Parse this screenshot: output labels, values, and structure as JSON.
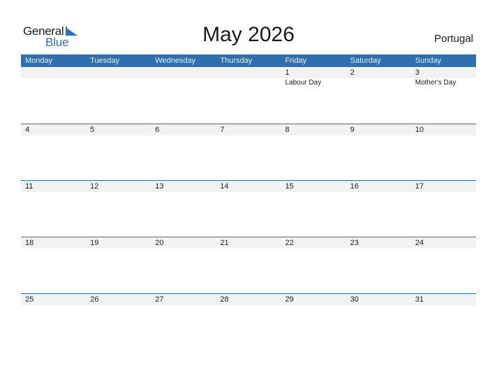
{
  "logo": {
    "line1": "General",
    "line2": "Blue"
  },
  "title": "May 2026",
  "country": "Portugal",
  "colors": {
    "accent": "#2e6fad",
    "strip": "#f2f2f2"
  },
  "days": [
    "Monday",
    "Tuesday",
    "Wednesday",
    "Thursday",
    "Friday",
    "Saturday",
    "Sunday"
  ],
  "weeks": [
    [
      {
        "d": "",
        "h": ""
      },
      {
        "d": "",
        "h": ""
      },
      {
        "d": "",
        "h": ""
      },
      {
        "d": "",
        "h": ""
      },
      {
        "d": "1",
        "h": "Labour Day"
      },
      {
        "d": "2",
        "h": ""
      },
      {
        "d": "3",
        "h": "Mother's Day"
      }
    ],
    [
      {
        "d": "4",
        "h": ""
      },
      {
        "d": "5",
        "h": ""
      },
      {
        "d": "6",
        "h": ""
      },
      {
        "d": "7",
        "h": ""
      },
      {
        "d": "8",
        "h": ""
      },
      {
        "d": "9",
        "h": ""
      },
      {
        "d": "10",
        "h": ""
      }
    ],
    [
      {
        "d": "11",
        "h": ""
      },
      {
        "d": "12",
        "h": ""
      },
      {
        "d": "13",
        "h": ""
      },
      {
        "d": "14",
        "h": ""
      },
      {
        "d": "15",
        "h": ""
      },
      {
        "d": "16",
        "h": ""
      },
      {
        "d": "17",
        "h": ""
      }
    ],
    [
      {
        "d": "18",
        "h": ""
      },
      {
        "d": "19",
        "h": ""
      },
      {
        "d": "20",
        "h": ""
      },
      {
        "d": "21",
        "h": ""
      },
      {
        "d": "22",
        "h": ""
      },
      {
        "d": "23",
        "h": ""
      },
      {
        "d": "24",
        "h": ""
      }
    ],
    [
      {
        "d": "25",
        "h": ""
      },
      {
        "d": "26",
        "h": ""
      },
      {
        "d": "27",
        "h": ""
      },
      {
        "d": "28",
        "h": ""
      },
      {
        "d": "29",
        "h": ""
      },
      {
        "d": "30",
        "h": ""
      },
      {
        "d": "31",
        "h": ""
      }
    ]
  ]
}
